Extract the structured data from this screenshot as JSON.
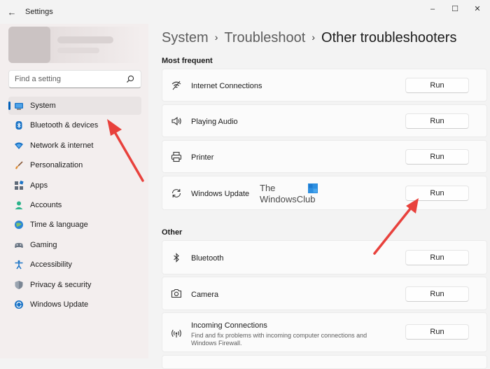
{
  "window": {
    "title": "Settings",
    "back_glyph": "←",
    "minimize_glyph": "–",
    "maximize_glyph": "☐",
    "close_glyph": "✕"
  },
  "search": {
    "placeholder": "Find a setting",
    "value": ""
  },
  "sidebar": {
    "items": [
      {
        "label": "System",
        "icon": "system-icon",
        "active": true
      },
      {
        "label": "Bluetooth & devices",
        "icon": "bluetooth-devices-icon"
      },
      {
        "label": "Network & internet",
        "icon": "network-icon"
      },
      {
        "label": "Personalization",
        "icon": "personalization-brush-icon"
      },
      {
        "label": "Apps",
        "icon": "apps-icon"
      },
      {
        "label": "Accounts",
        "icon": "accounts-icon"
      },
      {
        "label": "Time & language",
        "icon": "time-language-icon"
      },
      {
        "label": "Gaming",
        "icon": "gaming-icon"
      },
      {
        "label": "Accessibility",
        "icon": "accessibility-icon"
      },
      {
        "label": "Privacy & security",
        "icon": "shield-icon"
      },
      {
        "label": "Windows Update",
        "icon": "windows-update-icon"
      }
    ]
  },
  "breadcrumb": {
    "items": [
      "System",
      "Troubleshoot",
      "Other troubleshooters"
    ],
    "separator": "›"
  },
  "sections": {
    "most_frequent": {
      "title": "Most frequent",
      "items": [
        {
          "title": "Internet Connections",
          "icon": "wifi-icon",
          "button": "Run"
        },
        {
          "title": "Playing Audio",
          "icon": "speaker-icon",
          "button": "Run"
        },
        {
          "title": "Printer",
          "icon": "printer-icon",
          "button": "Run"
        },
        {
          "title": "Windows Update",
          "icon": "refresh-icon",
          "button": "Run"
        }
      ]
    },
    "other": {
      "title": "Other",
      "items": [
        {
          "title": "Bluetooth",
          "icon": "bluetooth-icon",
          "button": "Run"
        },
        {
          "title": "Camera",
          "icon": "camera-icon",
          "button": "Run"
        },
        {
          "title": "Incoming Connections",
          "icon": "incoming-connections-icon",
          "button": "Run",
          "description": "Find and fix problems with incoming computer connections and Windows Firewall."
        }
      ]
    }
  },
  "watermark": {
    "line1": "The",
    "line2": "WindowsClub"
  },
  "colors": {
    "accent": "#005fb8",
    "annotation_arrow": "#e8413c",
    "background": "#f3f3f3",
    "card": "#fbfbfb"
  }
}
